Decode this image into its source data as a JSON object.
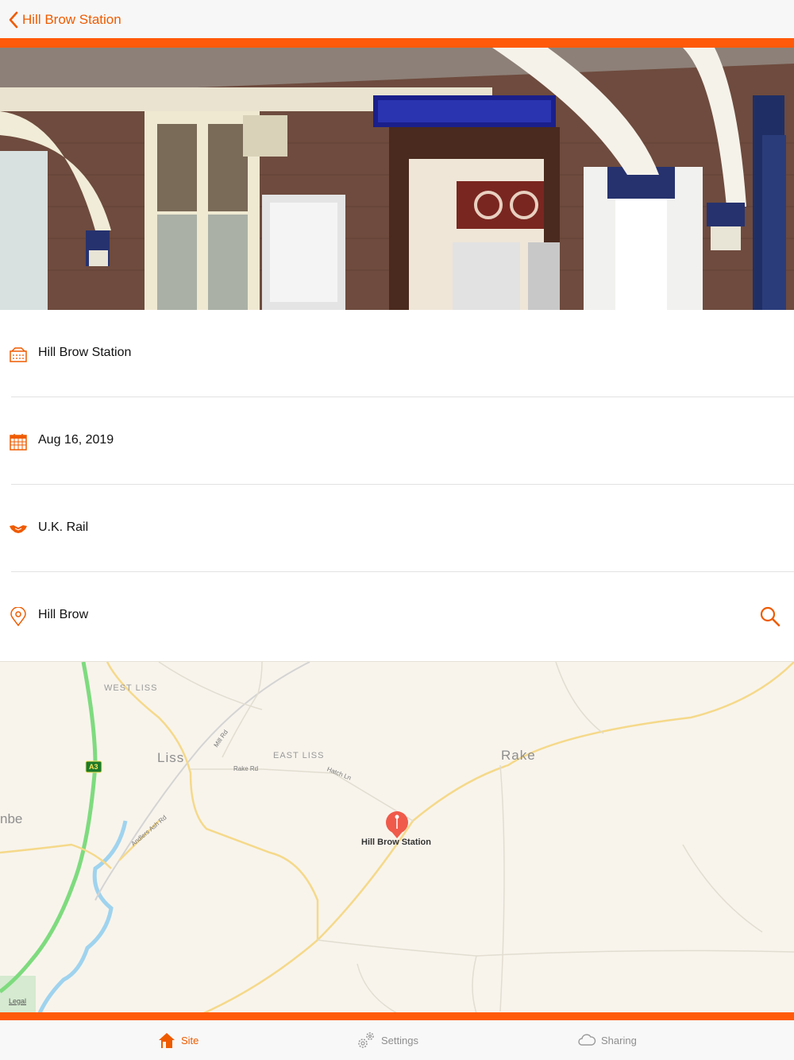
{
  "nav": {
    "back_label": "Hill Brow Station"
  },
  "details": {
    "name": "Hill Brow Station",
    "date": "Aug 16, 2019",
    "operator": "U.K. Rail",
    "location": "Hill Brow"
  },
  "map": {
    "labels": {
      "west_liss": "WEST LISS",
      "liss": "Liss",
      "east_liss": "EAST LISS",
      "rake": "Rake",
      "mill_rd": "Mill Rd",
      "rake_rd": "Rake Rd",
      "hatch_ln": "Hatch Ln",
      "andlers": "Andlers Ash Rd",
      "a3": "A3",
      "nbe": "nbe",
      "legal": "Legal"
    },
    "pin_label": "Hill Brow Station"
  },
  "tabs": [
    {
      "label": "Site"
    },
    {
      "label": "Settings"
    },
    {
      "label": "Sharing"
    }
  ],
  "colors": {
    "accent": "#ff5a0a",
    "tab_active": "#ef5b00",
    "pin": "#f05a4a",
    "road_major": "#7edb7e"
  }
}
